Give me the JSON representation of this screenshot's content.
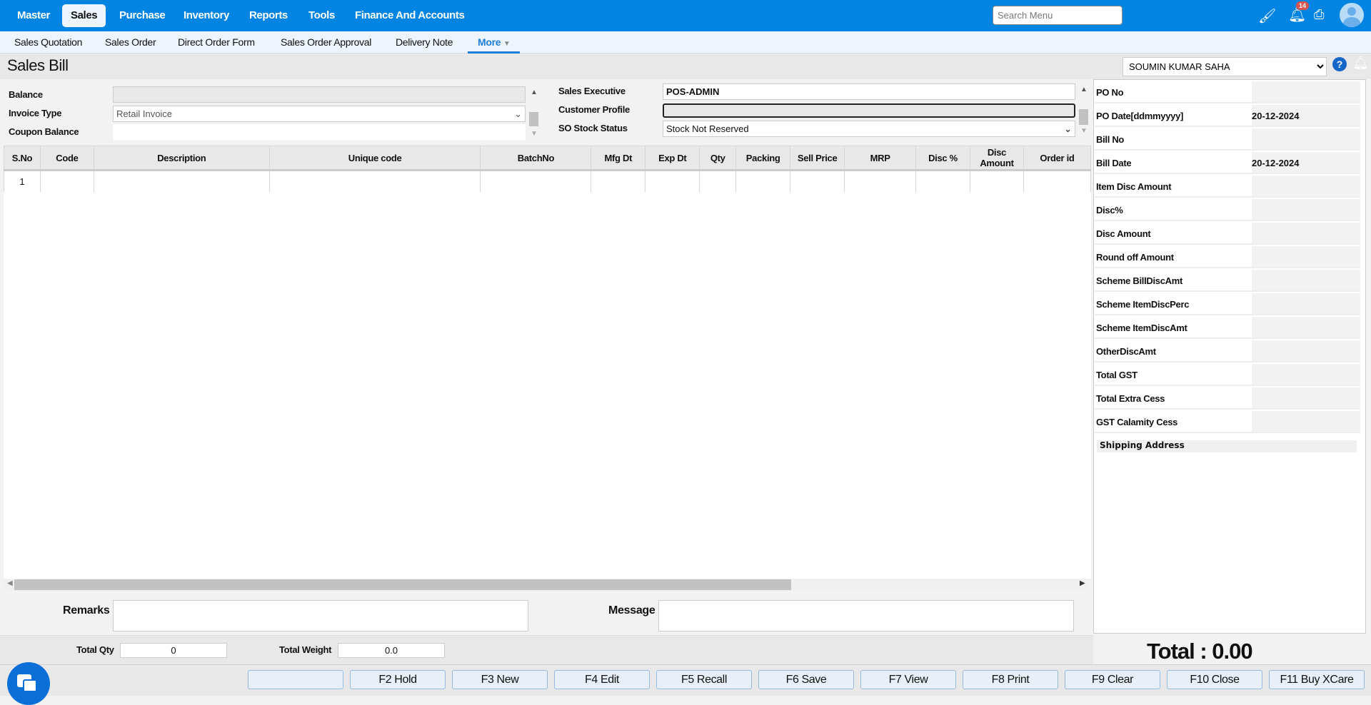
{
  "topnav": {
    "items": [
      "Master",
      "Sales",
      "Purchase",
      "Inventory",
      "Reports",
      "Tools",
      "Finance And Accounts"
    ],
    "active": "Sales",
    "search_placeholder": "Search Menu",
    "notification_count": "14"
  },
  "subnav": {
    "items": [
      "Sales Quotation",
      "Sales Order",
      "Direct Order Form",
      "Sales Order Approval",
      "Delivery Note"
    ],
    "more": "More"
  },
  "page": {
    "title": "Sales Bill",
    "customer": "SOUMIN KUMAR SAHA"
  },
  "form_left": {
    "balance_label": "Balance",
    "balance": "",
    "invoice_type_label": "Invoice Type",
    "invoice_type": "Retail Invoice",
    "coupon_label": "Coupon Balance",
    "coupon": ""
  },
  "form_right": {
    "exec_label": "Sales Executive",
    "exec": "POS-ADMIN",
    "profile_label": "Customer Profile",
    "stock_label": "SO Stock Status",
    "stock": "Stock Not Reserved"
  },
  "table": {
    "columns": [
      "S.No",
      "Code",
      "Description",
      "Unique code",
      "BatchNo",
      "Mfg Dt",
      "Exp Dt",
      "Qty",
      "Packing",
      "Sell Price",
      "MRP",
      "Disc %",
      "Disc Amount",
      "Order id"
    ],
    "rows": [
      [
        "1",
        "",
        "",
        "",
        "",
        "",
        "",
        "",
        "",
        "",
        "",
        "",
        "",
        ""
      ]
    ]
  },
  "summary": [
    {
      "label": "PO No",
      "value": ""
    },
    {
      "label": "PO Date[ddmmyyyy]",
      "value": "20-12-2024"
    },
    {
      "label": "Bill No",
      "value": ""
    },
    {
      "label": "Bill Date",
      "value": "20-12-2024"
    },
    {
      "label": "Item Disc Amount",
      "value": ""
    },
    {
      "label": "Disc%",
      "value": ""
    },
    {
      "label": "Disc Amount",
      "value": ""
    },
    {
      "label": "Round off Amount",
      "value": ""
    },
    {
      "label": "Scheme BillDiscAmt",
      "value": ""
    },
    {
      "label": "Scheme ItemDiscPerc",
      "value": ""
    },
    {
      "label": "Scheme ItemDiscAmt",
      "value": ""
    },
    {
      "label": "OtherDiscAmt",
      "value": ""
    },
    {
      "label": "Total GST",
      "value": ""
    },
    {
      "label": "Total Extra Cess",
      "value": ""
    },
    {
      "label": "GST Calamity Cess",
      "value": ""
    }
  ],
  "shipping_label": "Shipping Address",
  "remarks_label": "Remarks",
  "message_label": "Message",
  "totals": {
    "qty_label": "Total Qty",
    "qty": "0",
    "weight_label": "Total Weight",
    "weight": "0.0",
    "grand": "Total : 0.00"
  },
  "buttons": [
    "",
    "F2 Hold",
    "F3 New",
    "F4 Edit",
    "F5 Recall",
    "F6 Save",
    "F7 View",
    "F8 Print",
    "F9 Clear",
    "F10 Close",
    "F11 Buy XCare"
  ]
}
